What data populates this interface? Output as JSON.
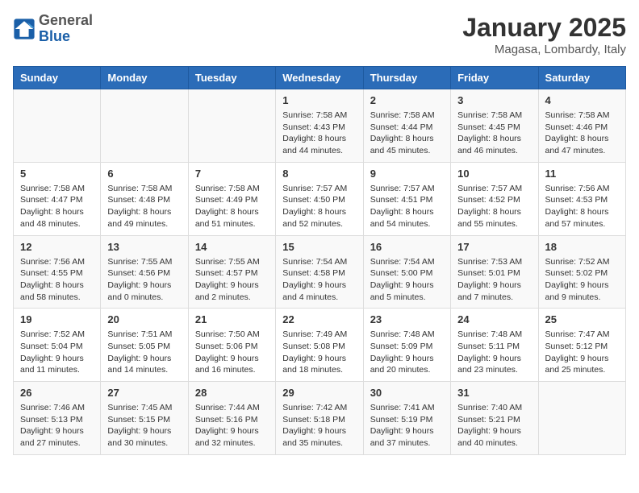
{
  "header": {
    "logo_general": "General",
    "logo_blue": "Blue",
    "month_title": "January 2025",
    "location": "Magasa, Lombardy, Italy"
  },
  "days_of_week": [
    "Sunday",
    "Monday",
    "Tuesday",
    "Wednesday",
    "Thursday",
    "Friday",
    "Saturday"
  ],
  "weeks": [
    [
      {
        "day": "",
        "info": ""
      },
      {
        "day": "",
        "info": ""
      },
      {
        "day": "",
        "info": ""
      },
      {
        "day": "1",
        "info": "Sunrise: 7:58 AM\nSunset: 4:43 PM\nDaylight: 8 hours\nand 44 minutes."
      },
      {
        "day": "2",
        "info": "Sunrise: 7:58 AM\nSunset: 4:44 PM\nDaylight: 8 hours\nand 45 minutes."
      },
      {
        "day": "3",
        "info": "Sunrise: 7:58 AM\nSunset: 4:45 PM\nDaylight: 8 hours\nand 46 minutes."
      },
      {
        "day": "4",
        "info": "Sunrise: 7:58 AM\nSunset: 4:46 PM\nDaylight: 8 hours\nand 47 minutes."
      }
    ],
    [
      {
        "day": "5",
        "info": "Sunrise: 7:58 AM\nSunset: 4:47 PM\nDaylight: 8 hours\nand 48 minutes."
      },
      {
        "day": "6",
        "info": "Sunrise: 7:58 AM\nSunset: 4:48 PM\nDaylight: 8 hours\nand 49 minutes."
      },
      {
        "day": "7",
        "info": "Sunrise: 7:58 AM\nSunset: 4:49 PM\nDaylight: 8 hours\nand 51 minutes."
      },
      {
        "day": "8",
        "info": "Sunrise: 7:57 AM\nSunset: 4:50 PM\nDaylight: 8 hours\nand 52 minutes."
      },
      {
        "day": "9",
        "info": "Sunrise: 7:57 AM\nSunset: 4:51 PM\nDaylight: 8 hours\nand 54 minutes."
      },
      {
        "day": "10",
        "info": "Sunrise: 7:57 AM\nSunset: 4:52 PM\nDaylight: 8 hours\nand 55 minutes."
      },
      {
        "day": "11",
        "info": "Sunrise: 7:56 AM\nSunset: 4:53 PM\nDaylight: 8 hours\nand 57 minutes."
      }
    ],
    [
      {
        "day": "12",
        "info": "Sunrise: 7:56 AM\nSunset: 4:55 PM\nDaylight: 8 hours\nand 58 minutes."
      },
      {
        "day": "13",
        "info": "Sunrise: 7:55 AM\nSunset: 4:56 PM\nDaylight: 9 hours\nand 0 minutes."
      },
      {
        "day": "14",
        "info": "Sunrise: 7:55 AM\nSunset: 4:57 PM\nDaylight: 9 hours\nand 2 minutes."
      },
      {
        "day": "15",
        "info": "Sunrise: 7:54 AM\nSunset: 4:58 PM\nDaylight: 9 hours\nand 4 minutes."
      },
      {
        "day": "16",
        "info": "Sunrise: 7:54 AM\nSunset: 5:00 PM\nDaylight: 9 hours\nand 5 minutes."
      },
      {
        "day": "17",
        "info": "Sunrise: 7:53 AM\nSunset: 5:01 PM\nDaylight: 9 hours\nand 7 minutes."
      },
      {
        "day": "18",
        "info": "Sunrise: 7:52 AM\nSunset: 5:02 PM\nDaylight: 9 hours\nand 9 minutes."
      }
    ],
    [
      {
        "day": "19",
        "info": "Sunrise: 7:52 AM\nSunset: 5:04 PM\nDaylight: 9 hours\nand 11 minutes."
      },
      {
        "day": "20",
        "info": "Sunrise: 7:51 AM\nSunset: 5:05 PM\nDaylight: 9 hours\nand 14 minutes."
      },
      {
        "day": "21",
        "info": "Sunrise: 7:50 AM\nSunset: 5:06 PM\nDaylight: 9 hours\nand 16 minutes."
      },
      {
        "day": "22",
        "info": "Sunrise: 7:49 AM\nSunset: 5:08 PM\nDaylight: 9 hours\nand 18 minutes."
      },
      {
        "day": "23",
        "info": "Sunrise: 7:48 AM\nSunset: 5:09 PM\nDaylight: 9 hours\nand 20 minutes."
      },
      {
        "day": "24",
        "info": "Sunrise: 7:48 AM\nSunset: 5:11 PM\nDaylight: 9 hours\nand 23 minutes."
      },
      {
        "day": "25",
        "info": "Sunrise: 7:47 AM\nSunset: 5:12 PM\nDaylight: 9 hours\nand 25 minutes."
      }
    ],
    [
      {
        "day": "26",
        "info": "Sunrise: 7:46 AM\nSunset: 5:13 PM\nDaylight: 9 hours\nand 27 minutes."
      },
      {
        "day": "27",
        "info": "Sunrise: 7:45 AM\nSunset: 5:15 PM\nDaylight: 9 hours\nand 30 minutes."
      },
      {
        "day": "28",
        "info": "Sunrise: 7:44 AM\nSunset: 5:16 PM\nDaylight: 9 hours\nand 32 minutes."
      },
      {
        "day": "29",
        "info": "Sunrise: 7:42 AM\nSunset: 5:18 PM\nDaylight: 9 hours\nand 35 minutes."
      },
      {
        "day": "30",
        "info": "Sunrise: 7:41 AM\nSunset: 5:19 PM\nDaylight: 9 hours\nand 37 minutes."
      },
      {
        "day": "31",
        "info": "Sunrise: 7:40 AM\nSunset: 5:21 PM\nDaylight: 9 hours\nand 40 minutes."
      },
      {
        "day": "",
        "info": ""
      }
    ]
  ]
}
